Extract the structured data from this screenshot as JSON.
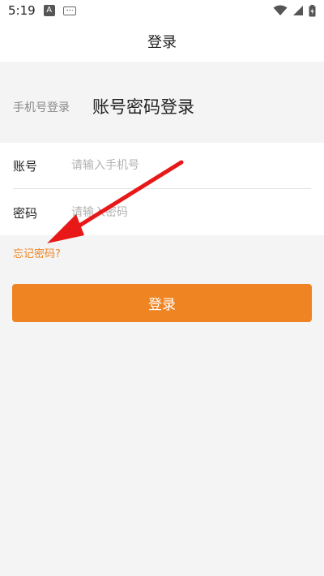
{
  "status_bar": {
    "time": "5:19",
    "app_icon_letter": "A",
    "icons": [
      "app-notification-icon",
      "keyboard-icon",
      "wifi-icon",
      "signal-icon",
      "battery-charging-icon"
    ]
  },
  "header": {
    "title": "登录"
  },
  "tabs": {
    "phone_login": "手机号登录",
    "password_login": "账号密码登录"
  },
  "form": {
    "account_label": "账号",
    "account_placeholder": "请输入手机号",
    "account_value": "",
    "password_label": "密码",
    "password_placeholder": "请输入密码",
    "password_value": ""
  },
  "forgot_password": "忘记密码?",
  "login_button": "登录",
  "colors": {
    "accent": "#ef8422",
    "annotation": "#e81818",
    "background": "#f4f4f4"
  }
}
